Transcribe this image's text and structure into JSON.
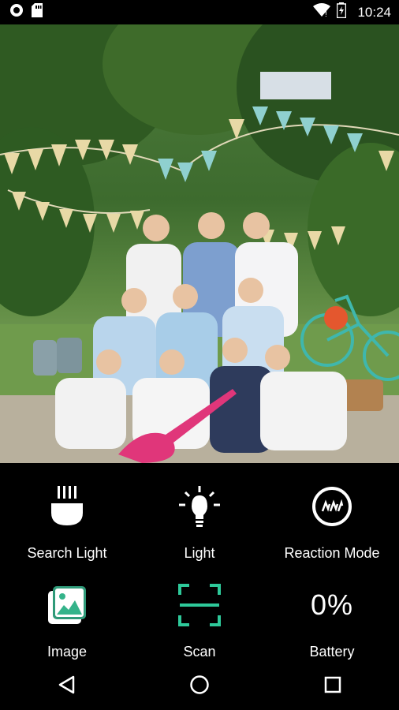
{
  "status_bar": {
    "time": "10:24",
    "icons": [
      "circle-notification-icon",
      "sd-card-icon",
      "wifi-icon",
      "battery-charging-icon"
    ]
  },
  "photo": {
    "description_icon": "group-photo"
  },
  "grid": {
    "items": [
      {
        "label": "Search Light",
        "icon": "searchlight-icon"
      },
      {
        "label": "Light",
        "icon": "lightbulb-icon"
      },
      {
        "label": "Reaction Mode",
        "icon": "reaction-mode-icon"
      },
      {
        "label": "Image",
        "icon": "image-gallery-icon"
      },
      {
        "label": "Scan",
        "icon": "scan-frame-icon"
      },
      {
        "label": "Battery",
        "icon": "battery-text",
        "value": "0%"
      }
    ]
  },
  "colors": {
    "background": "#000000",
    "text": "#ffffff",
    "scan_accent": "#2ec99a"
  },
  "nav": {
    "buttons": [
      "back-icon",
      "home-icon",
      "recents-icon"
    ]
  }
}
